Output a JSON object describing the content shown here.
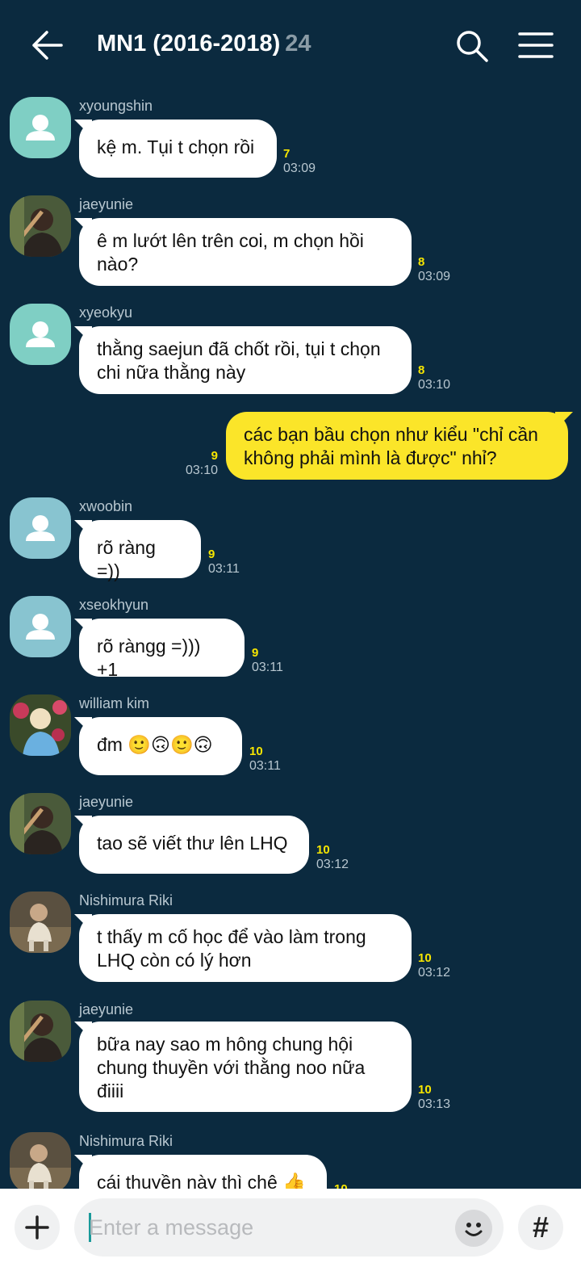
{
  "header": {
    "title": "MN1 (2016-2018)",
    "member_count": "24",
    "icons": [
      "back-arrow-icon",
      "search-icon",
      "menu-icon"
    ]
  },
  "messages": [
    {
      "sender": "xyoungshin",
      "avatar": "default",
      "text": "kệ m. Tụi t chọn rồi",
      "unread": "7",
      "time": "03:09"
    },
    {
      "sender": "jaeyunie",
      "avatar": "photo-violin",
      "text": "ê m lướt lên trên coi, m chọn hồi nào?",
      "unread": "8",
      "time": "03:09"
    },
    {
      "sender": "xyeokyu",
      "avatar": "default",
      "text": "thằng saejun đã chốt rồi, tụi t chọn chi nữa thằng này",
      "unread": "8",
      "time": "03:10"
    },
    {
      "sender": "",
      "mine": true,
      "text": "các bạn bầu chọn như kiểu \"chỉ cần không phải mình là được\" nhỉ?",
      "unread": "9",
      "time": "03:10"
    },
    {
      "sender": "xwoobin",
      "avatar": "default",
      "text": "rõ ràng =))",
      "unread": "9",
      "time": "03:11"
    },
    {
      "sender": "xseokhyun",
      "avatar": "default",
      "text": "rõ ràngg =))) +1",
      "unread": "9",
      "time": "03:11"
    },
    {
      "sender": "william kim",
      "avatar": "photo-flowers",
      "text": "đm 🙂🙃🙂🙃",
      "unread": "10",
      "time": "03:11"
    },
    {
      "sender": "jaeyunie",
      "avatar": "photo-violin",
      "text": "tao sẽ viết thư lên LHQ",
      "unread": "10",
      "time": "03:12"
    },
    {
      "sender": "Nishimura Riki",
      "avatar": "photo-bench",
      "text": "t thấy m cố học để vào làm trong LHQ còn có lý hơn",
      "unread": "10",
      "time": "03:12"
    },
    {
      "sender": "jaeyunie",
      "avatar": "photo-violin",
      "text": "bữa nay sao m hông chung hội chung thuyền với thằng noo nữa điiii",
      "unread": "10",
      "time": "03:13"
    },
    {
      "sender": "Nishimura Riki",
      "avatar": "photo-bench",
      "text": "cái thuyền này thì chê 👍",
      "unread": "10",
      "time": ""
    }
  ],
  "composer": {
    "placeholder": "Enter a message",
    "icons": [
      "plus-icon",
      "emoji-icon",
      "hashtag-icon"
    ],
    "hash_label": "#"
  }
}
